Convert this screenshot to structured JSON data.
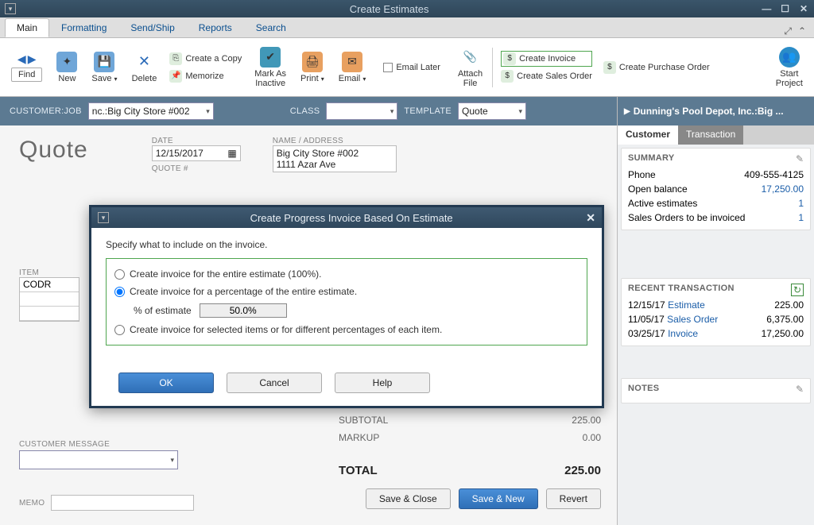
{
  "window": {
    "title": "Create Estimates"
  },
  "tabs": {
    "t0": "Main",
    "t1": "Formatting",
    "t2": "Send/Ship",
    "t3": "Reports",
    "t4": "Search"
  },
  "ribbon": {
    "find": "Find",
    "new": "New",
    "save": "Save",
    "delete": "Delete",
    "create_copy": "Create a Copy",
    "memorize": "Memorize",
    "mark_inactive": "Mark As\nInactive",
    "print": "Print",
    "email": "Email",
    "email_later": "Email Later",
    "attach_file": "Attach\nFile",
    "create_invoice": "Create Invoice",
    "create_sales_order": "Create Sales Order",
    "create_po": "Create Purchase Order",
    "start_project": "Start\nProject"
  },
  "form_header": {
    "customer_label": "CUSTOMER:JOB",
    "customer_value": "nc.:Big City Store #002",
    "class_label": "CLASS",
    "class_value": "",
    "template_label": "TEMPLATE",
    "template_value": "Quote"
  },
  "form": {
    "doc_title": "Quote",
    "date_label": "DATE",
    "date_value": "12/15/2017",
    "quote_no_label": "QUOTE #",
    "name_addr_label": "NAME / ADDRESS",
    "name_addr_line1": "Big City Store #002",
    "name_addr_line2": "1111 Azar Ave",
    "item_label": "ITEM",
    "item_value": "CODR",
    "subtotal_label": "SUBTOTAL",
    "subtotal_value": "225.00",
    "markup_label": "MARKUP",
    "markup_value": "0.00",
    "total_label": "TOTAL",
    "total_value": "225.00",
    "customer_message_label": "CUSTOMER MESSAGE",
    "memo_label": "MEMO",
    "save_close": "Save & Close",
    "save_new": "Save & New",
    "revert": "Revert"
  },
  "side": {
    "header": "Dunning's Pool Depot, Inc.:Big ...",
    "tab_customer": "Customer",
    "tab_transaction": "Transaction",
    "summary_h": "SUMMARY",
    "phone_l": "Phone",
    "phone_v": "409-555-4125",
    "openbal_l": "Open balance",
    "openbal_v": "17,250.00",
    "active_est_l": "Active estimates",
    "active_est_v": "1",
    "so_inv_l": "Sales Orders to be invoiced",
    "so_inv_v": "1",
    "recent_h": "RECENT TRANSACTION",
    "r1_date": "12/15/17",
    "r1_type": "Estimate",
    "r1_amt": "225.00",
    "r2_date": "11/05/17",
    "r2_type": "Sales Order",
    "r2_amt": "6,375.00",
    "r3_date": "03/25/17",
    "r3_type": "Invoice",
    "r3_amt": "17,250.00",
    "notes_h": "NOTES"
  },
  "dialog": {
    "title": "Create Progress Invoice Based On Estimate",
    "instruction": "Specify what to include on the invoice.",
    "opt1": "Create invoice for the entire estimate (100%).",
    "opt2": "Create invoice for a percentage of the entire estimate.",
    "pct_label": "% of estimate",
    "pct_value": "50.0%",
    "opt3": "Create invoice for selected items or for different percentages of each item.",
    "ok": "OK",
    "cancel": "Cancel",
    "help": "Help"
  }
}
